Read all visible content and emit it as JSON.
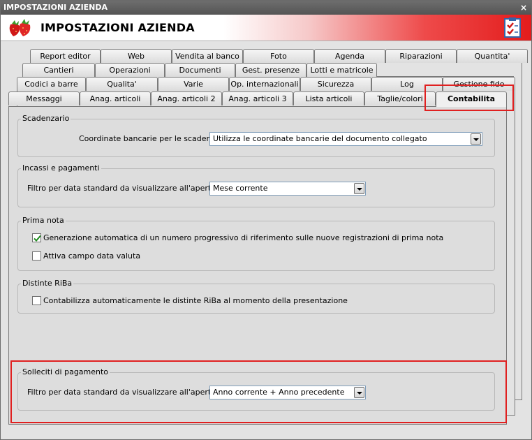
{
  "window": {
    "titlebar": "IMPOSTAZIONI AZIENDA",
    "close_glyph": "×",
    "header_title": "IMPOSTAZIONI AZIENDA",
    "logo_icon": "strawberry-icon",
    "header_icon": "checklist-icon"
  },
  "tabs": {
    "row1": [
      "Report editor",
      "Web",
      "Vendita al banco",
      "Foto",
      "Agenda",
      "Riparazioni",
      "Quantita'"
    ],
    "row2": [
      "Cantieri",
      "Operazioni",
      "Documenti",
      "Gest. presenze",
      "Lotti e matricole"
    ],
    "row3": [
      "Codici a barre",
      "Qualita'",
      "Varie",
      "Op. internazionali",
      "Sicurezza",
      "Log",
      "Gestione fido"
    ],
    "row4": [
      "Messaggi",
      "Anag. articoli",
      "Anag. articoli 2",
      "Anag. articoli 3",
      "Lista articoli",
      "Taglie/colori",
      "Contabilita"
    ],
    "active": "Contabilita"
  },
  "scadenzario": {
    "title": "Scadenzario",
    "label": "Coordinate bancarie per le scadenze :",
    "value": "Utilizza le coordinate bancarie del documento collegato"
  },
  "incassi": {
    "title": "Incassi e pagamenti",
    "label": "Filtro per data standard da visualizzare all'apertura :",
    "value": "Mese corrente"
  },
  "prima_nota": {
    "title": "Prima nota",
    "check1_label": "Generazione automatica di un numero progressivo di riferimento sulle nuove registrazioni di prima nota",
    "check1_checked": true,
    "check2_label": "Attiva campo data valuta",
    "check2_checked": false
  },
  "riba": {
    "title": "Distinte RiBa",
    "check_label": "Contabilizza automaticamente le distinte RiBa al momento della presentazione",
    "check_checked": false
  },
  "solleciti": {
    "title": "Solleciti di pagamento",
    "label": "Filtro per data standard da visualizzare all'apertura :",
    "value": "Anno corrente + Anno precedente"
  },
  "colors": {
    "highlight": "#e02020",
    "header_gradient_end": "#e31c1c",
    "check_mark": "#1c8a1c"
  }
}
